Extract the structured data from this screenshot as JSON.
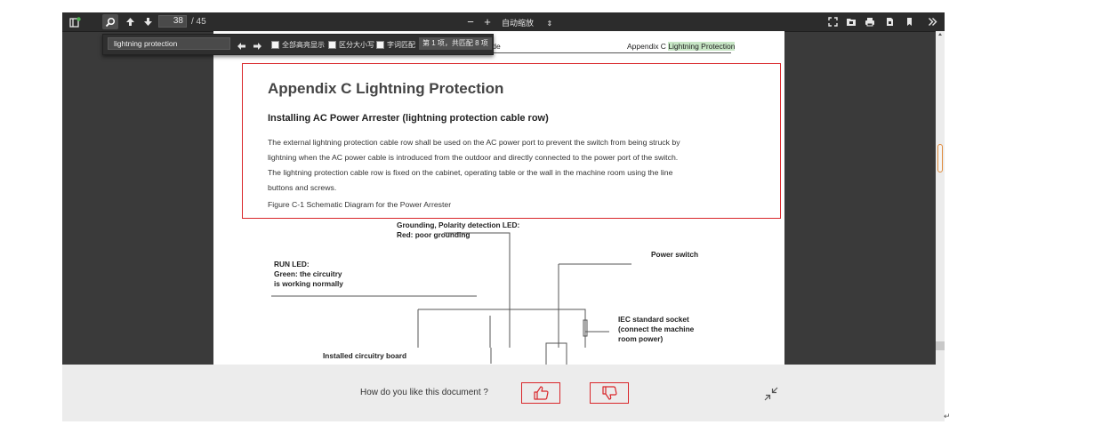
{
  "toolbar": {
    "page_current": "38",
    "page_total": "/ 45",
    "zoom_minus": "−",
    "zoom_plus": "+",
    "zoom_label": "自动缩放",
    "zoom_caret": "⇕"
  },
  "findbar": {
    "query": "lightning protection",
    "highlight_all": "全部高亮显示",
    "match_case": "区分大小写",
    "whole_word": "字词匹配",
    "result_count": "第 1 项，共匹配 8 项"
  },
  "document": {
    "header_left": "nce Guide",
    "header_right_prefix": "Appendix C ",
    "header_right_highlight": "Lightning Protection",
    "title": "Appendix C Lightning Protection",
    "subtitle": "Installing AC Power Arrester (lightning protection cable row)",
    "paragraph": [
      "The external lightning protection cable row shall be used on the AC power port to prevent the switch from being struck by",
      "lightning when the AC power cable is introduced from the outdoor and directly connected to the power port of the switch.",
      "The lightning protection cable row is fixed on the cabinet, operating table or the wall in the machine room using the line",
      "buttons and screws."
    ],
    "figure_caption": "Figure C-1 Schematic Diagram for the Power Arrester"
  },
  "diagram": {
    "grounding_line1": "Grounding, Polarity detection LED:",
    "grounding_line2": "Red: poor grounding",
    "run_led_line1": "RUN LED:",
    "run_led_line2": "Green: the circuitry",
    "run_led_line3": "is working normally",
    "power_switch": "Power switch",
    "iec_line1": "IEC standard socket",
    "iec_line2": "(connect the machine",
    "iec_line3": "room power)",
    "circuit_board": "Installed circuitry board"
  },
  "feedback": {
    "question": "How do you like this document ?"
  },
  "return_mark": "↵",
  "colors": {
    "accent_red": "#d9262a",
    "highlight_green": "#c7e6c5",
    "scroll_thumb_border": "#e08a3a"
  }
}
